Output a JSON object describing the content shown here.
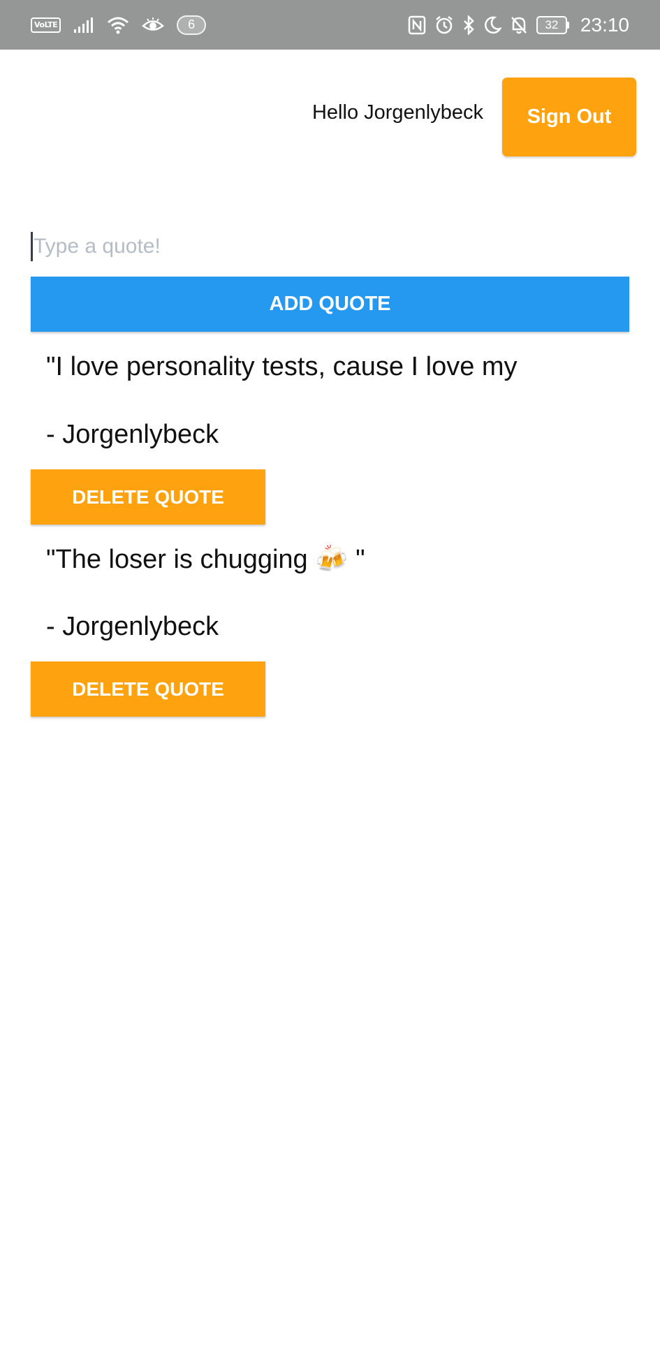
{
  "status_bar": {
    "network_badge": "VoLTE",
    "notification_count": "6",
    "battery": "32",
    "time": "23:10",
    "icons": [
      "volte-icon",
      "signal-icon",
      "wifi-icon",
      "eye-icon",
      "nfc-icon",
      "alarm-icon",
      "bluetooth-icon",
      "moon-icon",
      "bell-off-icon",
      "battery-icon"
    ]
  },
  "header": {
    "greeting": "Hello Jorgenlybeck",
    "sign_out_label": "Sign Out"
  },
  "quote_input": {
    "placeholder": "Type a quote!"
  },
  "add_button_label": "ADD QUOTE",
  "quotes": [
    {
      "text": "\"I love personality tests, cause I love my",
      "author": "- Jorgenlybeck",
      "delete_label": "DELETE QUOTE"
    },
    {
      "text": "\"The loser is chugging 🍻 \"",
      "author": "- Jorgenlybeck",
      "delete_label": "DELETE QUOTE"
    }
  ],
  "colors": {
    "status_bar": "#959796",
    "accent_orange": "#fea30f",
    "accent_blue": "#2598ef",
    "placeholder": "#b4bcc6"
  }
}
